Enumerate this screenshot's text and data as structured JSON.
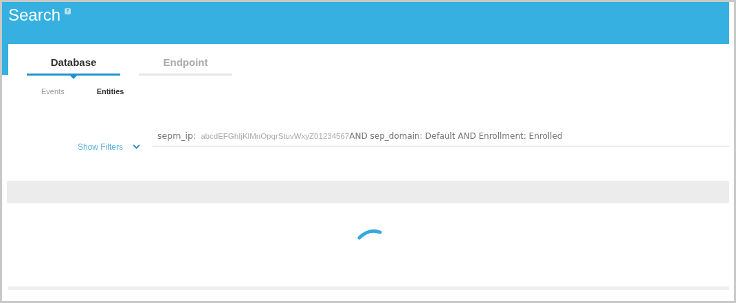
{
  "header": {
    "title": "Search",
    "help": "?"
  },
  "tabs": [
    {
      "label": "Database",
      "selected": true
    },
    {
      "label": "Endpoint",
      "selected": false
    }
  ],
  "subtabs": [
    {
      "label": "Events",
      "selected": false
    },
    {
      "label": "Entities",
      "selected": true
    }
  ],
  "filters": {
    "toggle": "Show Filters",
    "expanded": false
  },
  "query": {
    "key": "sepm_ip:",
    "value": "abcdEFGhIjKlMnOpqrStuvWxyZ01234567",
    "rest": "AND sep_domain: Default AND Enrollment: Enrolled"
  },
  "results": {
    "loading": true
  }
}
